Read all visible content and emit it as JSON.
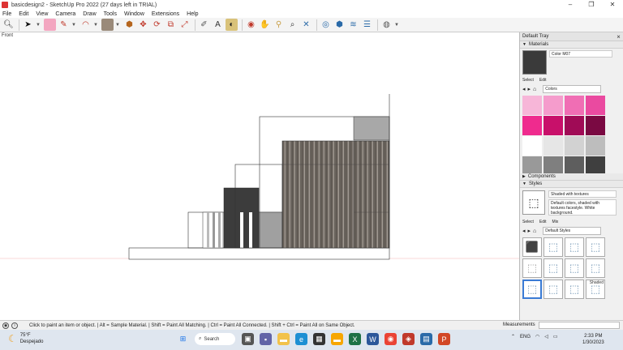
{
  "window": {
    "title": "basicdesign2 - SketchUp Pro 2022 (27 days left in TRIAL)",
    "controls": [
      "–",
      "❐",
      "✕"
    ]
  },
  "menu": [
    "File",
    "Edit",
    "View",
    "Camera",
    "Draw",
    "Tools",
    "Window",
    "Extensions",
    "Help"
  ],
  "toolbar": {
    "icons": [
      "zoom-icon",
      "select-icon",
      "eraser-icon",
      "pencil-icon",
      "shape-icon",
      "paint-bucket-icon",
      "push-pull-icon",
      "move-icon",
      "rotate-icon",
      "offset-icon",
      "tape-measure-icon",
      "text-icon",
      "orbit-icon",
      "pan-icon",
      "walk-icon",
      "section-icon",
      "zoom-extents-icon",
      "sandbox-icon",
      "layers-icon",
      "stack-icon",
      "warehouse-icon",
      "extension-icon"
    ]
  },
  "viewport": {
    "view_label": "Front"
  },
  "tray": {
    "title": "Default Tray",
    "materials": {
      "header": "Materials",
      "current_name": "Color M07",
      "current_color": "#3a3a3a",
      "tabs": [
        "Select",
        "Edit"
      ],
      "library": "Colors",
      "swatches": [
        "#f7b6d8",
        "#f59ccc",
        "#f06eb4",
        "#ea4aa0",
        "#ef2b8e",
        "#c8106a",
        "#a00b56",
        "#7a0942",
        "#ffffff",
        "#e6e6e6",
        "#d2d2d2",
        "#bdbdbd",
        "#999999",
        "#7f7f7f",
        "#5e5e5e",
        "#3f3f3f",
        "#222222",
        "#000000"
      ]
    },
    "components": {
      "header": "Components"
    },
    "styles": {
      "header": "Styles",
      "current_name": "Shaded with textures",
      "description": "Default colors, shaded with textures facestyle. White background.",
      "tabs": [
        "Select",
        "Edit",
        "Mix"
      ],
      "library": "Default Styles",
      "tile_label": "Shaded"
    }
  },
  "status": {
    "message": "Click to paint an item or object. | Alt = Sample Material. | Shift = Paint All Matching. | Ctrl = Paint All Connected. | Shift + Ctrl = Paint All on Same Object.",
    "measurements_label": "Measurements"
  },
  "taskbar": {
    "temperature": "75°F",
    "weather": "Despejado",
    "search_label": "Search",
    "language": "ENG",
    "time": "2:33 PM",
    "date": "1/30/2023"
  }
}
